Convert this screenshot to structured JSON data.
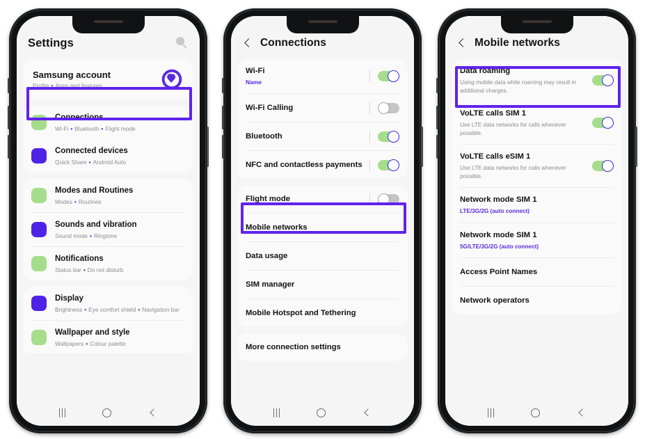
{
  "colors": {
    "highlight": "#6022ee",
    "accent_purple": "#5b2ae0",
    "icon_green": "#a5dd8c",
    "icon_purple": "#5022e8",
    "toggle_on_track": "#a5dd8c",
    "toggle_off_track": "#c4c4c4",
    "toggle_thumb_border_on": "#4026e6"
  },
  "phones": [
    {
      "id": "phone-settings",
      "header": {
        "title": "Settings",
        "has_back": false,
        "search_icon": "search-icon"
      },
      "account": {
        "title": "Samsung account",
        "subtitle_parts": [
          "Profile",
          "Apps and features"
        ],
        "logo": "samsung-account-logo"
      },
      "groups": [
        {
          "rows": [
            {
              "title": "Connections",
              "subtitle_parts": [
                "Wi-Fi",
                "Bluetooth",
                "Flight mode"
              ],
              "icon_color": "#a5dd8c",
              "highlighted": true
            },
            {
              "title": "Connected devices",
              "subtitle_parts": [
                "Quick Share",
                "Android Auto"
              ],
              "icon_color": "#5022e8",
              "highlighted": false
            }
          ]
        },
        {
          "rows": [
            {
              "title": "Modes and Routines",
              "subtitle_parts": [
                "Modes",
                "Routines"
              ],
              "icon_color": "#a5dd8c",
              "highlighted": false
            },
            {
              "title": "Sounds and vibration",
              "subtitle_parts": [
                "Sound mode",
                "Ringtone"
              ],
              "icon_color": "#5022e8",
              "highlighted": false
            },
            {
              "title": "Notifications",
              "subtitle_parts": [
                "Status bar",
                "Do not disturb"
              ],
              "icon_color": "#a5dd8c",
              "highlighted": false
            }
          ]
        },
        {
          "rows": [
            {
              "title": "Display",
              "subtitle_parts": [
                "Brightness",
                "Eye comfort shield",
                "Navigation bar"
              ],
              "icon_color": "#5022e8",
              "highlighted": false
            },
            {
              "title": "Wallpaper and style",
              "subtitle_parts": [
                "Wallpapers",
                "Colour palette"
              ],
              "icon_color": "#a5dd8c",
              "highlighted": false
            }
          ]
        }
      ],
      "navbar": {
        "recents": "recents-icon",
        "home": "home-icon",
        "back": "back-icon"
      }
    },
    {
      "id": "phone-connections",
      "header": {
        "title": "Connections",
        "has_back": true
      },
      "groups": [
        {
          "rows": [
            {
              "title": "Wi-Fi",
              "value": "Name",
              "toggle": "on",
              "divider_before_toggle": true
            },
            {
              "title": "Wi-Fi Calling",
              "toggle": "off",
              "divider_before_toggle": true
            },
            {
              "title": "Bluetooth",
              "toggle": "on",
              "divider_before_toggle": true
            },
            {
              "title": "NFC and contactless payments",
              "toggle": "on",
              "divider_before_toggle": true
            }
          ]
        },
        {
          "rows": [
            {
              "title": "Flight mode",
              "toggle": "off",
              "divider_before_toggle": true
            },
            {
              "title": "Mobile networks",
              "highlighted": true
            },
            {
              "title": "Data usage"
            },
            {
              "title": "SIM manager"
            },
            {
              "title": "Mobile Hotspot and Tethering"
            }
          ]
        },
        {
          "rows": [
            {
              "title": "More connection settings"
            }
          ]
        }
      ],
      "navbar": {
        "recents": "recents-icon",
        "home": "home-icon",
        "back": "back-icon"
      }
    },
    {
      "id": "phone-mobile-networks",
      "header": {
        "title": "Mobile networks",
        "has_back": true
      },
      "groups": [
        {
          "rows": [
            {
              "title": "Data roaming",
              "subtitle": "Using mobile data while roaming may result in additional charges.",
              "toggle": "on",
              "highlighted": true
            },
            {
              "title": "VoLTE calls SIM 1",
              "subtitle": "Use LTE data networks for calls whenever possible.",
              "toggle": "on"
            },
            {
              "title": "VoLTE calls eSIM 1",
              "subtitle": "Use LTE data networks for calls whenever possible.",
              "toggle": "on"
            },
            {
              "title": "Network mode SIM 1",
              "value": "LTE/3G/2G (auto connect)"
            },
            {
              "title": "Network mode SIM 1",
              "value": "5G/LTE/3G/2G (auto connect)"
            },
            {
              "title": "Access Point Names"
            },
            {
              "title": "Network operators"
            }
          ]
        }
      ],
      "navbar": {
        "recents": "recents-icon",
        "home": "home-icon",
        "back": "back-icon"
      }
    }
  ]
}
